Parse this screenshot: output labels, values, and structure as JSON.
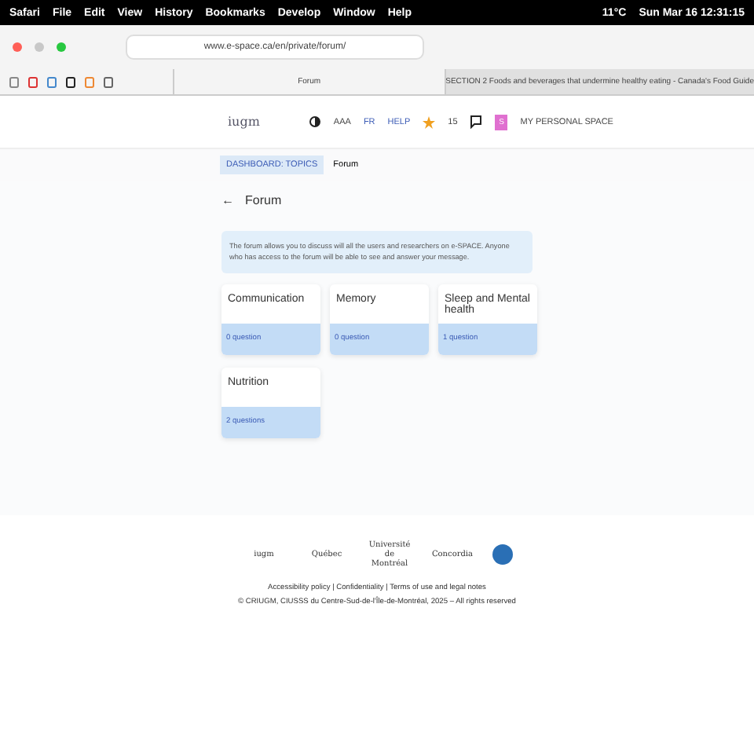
{
  "menu_bar": {
    "items": [
      "Safari",
      "File",
      "Edit",
      "View",
      "History",
      "Bookmarks",
      "Develop",
      "Window",
      "Help"
    ],
    "weather": "11°C",
    "clock": "Sun Mar 16  12:31:15"
  },
  "toolbar": {
    "url": "www.e-space.ca/en/private/forum/"
  },
  "tabs": [
    {
      "label": "Forum",
      "selected": true
    },
    {
      "label": "SECTION 2 Foods and beverages that undermine healthy eating - Canada's Food Guide",
      "selected": false
    }
  ],
  "header": {
    "logo": "iugm",
    "font_size": "AAA",
    "language": "FR",
    "help": "HELP",
    "stars": "15",
    "avatar": "S",
    "personal_space": "MY PERSONAL SPACE"
  },
  "breadcrumb": [
    "DASHBOARD: TOPICS",
    "Forum"
  ],
  "back_arrow": "←",
  "title": "Forum",
  "info": "The forum allows you to discuss will all the users and researchers on e-SPACE. Anyone who has access to the forum will be able to see and answer your message.",
  "topics": [
    {
      "name": "Communication",
      "count": "0 question"
    },
    {
      "name": "Memory",
      "count": "0 question"
    },
    {
      "name": "Sleep and Mental health",
      "count": "1 question"
    },
    {
      "name": "Nutrition",
      "count": "2 questions"
    }
  ],
  "footer": {
    "logos": [
      "iugm",
      "Québec",
      "Université de Montréal",
      "Concordia"
    ],
    "links": "Accessibility policy | Confidentiality | Terms of use and legal notes",
    "copyright": "© CRIUGM, CIUSSS du Centre-Sud-de-l'Île-de-Montréal, 2025 – All rights reserved"
  }
}
